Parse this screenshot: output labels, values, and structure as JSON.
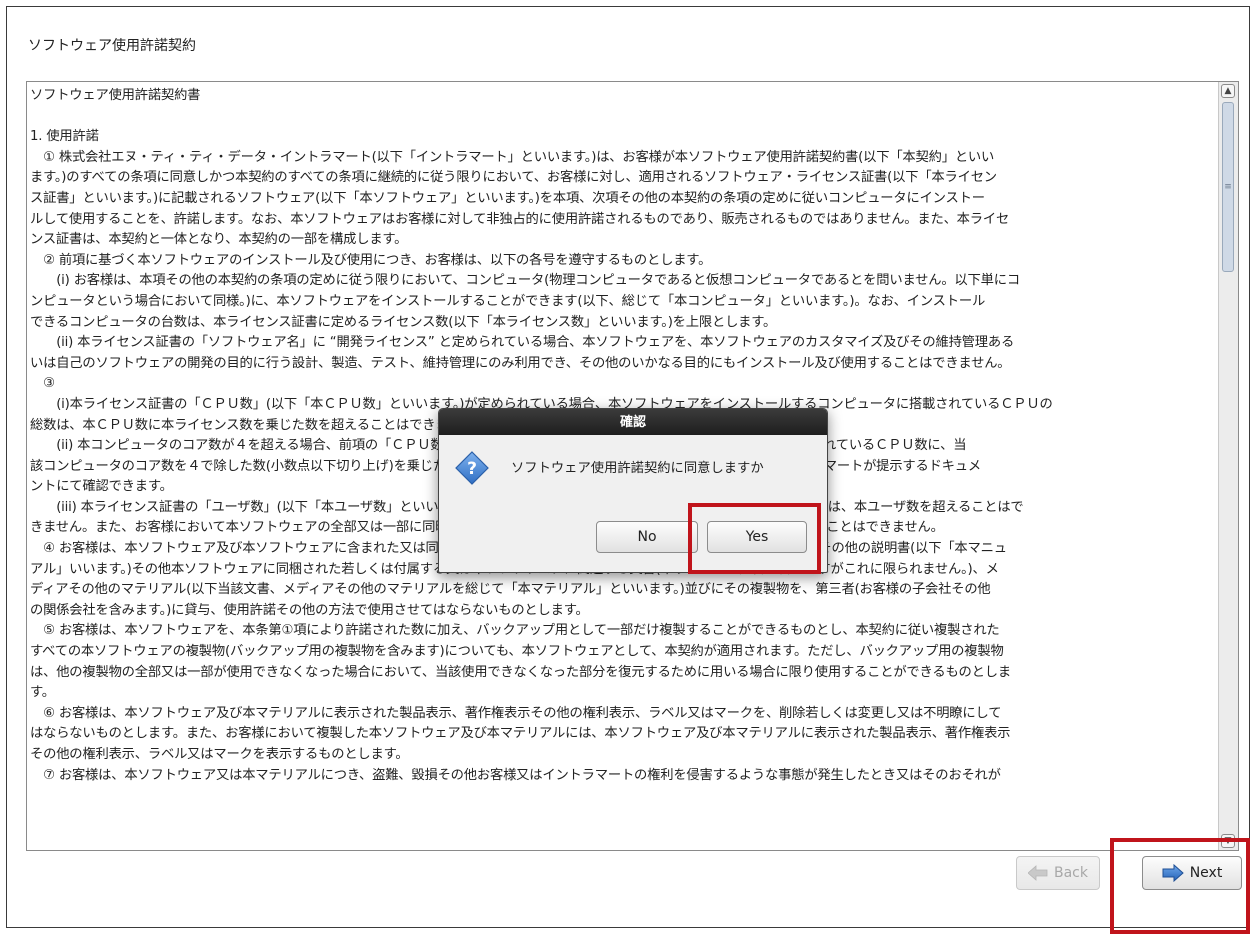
{
  "window": {
    "title": "ソフトウェア使用許諾契約"
  },
  "license": {
    "lines": [
      "ソフトウェア使用許諾契約書",
      "",
      "1. 使用許諾",
      "　① 株式会社エヌ・ティ・ティ・データ・イントラマート(以下「イントラマート」といいます。)は、お客様が本ソフトウェア使用許諾契約書(以下「本契約」といい",
      "ます。)のすべての条項に同意しかつ本契約のすべての条項に継続的に従う限りにおいて、お客様に対し、適用されるソフトウェア・ライセンス証書(以下「本ライセン",
      "ス証書」といいます。)に記載されるソフトウェア(以下「本ソフトウェア」といいます。)を本項、次項その他の本契約の条項の定めに従いコンピュータにインストー",
      "ルして使用することを、許諾します。なお、本ソフトウェアはお客様に対して非独占的に使用許諾されるものであり、販売されるものではありません。また、本ライセ",
      "ンス証書は、本契約と一体となり、本契約の一部を構成します。",
      "　② 前項に基づく本ソフトウェアのインストール及び使用につき、お客様は、以下の各号を遵守するものとします。",
      "　　(i) お客様は、本項その他の本契約の条項の定めに従う限りにおいて、コンピュータ(物理コンピュータであると仮想コンピュータであるとを問いません。以下単にコ",
      "ンピュータという場合において同様。)に、本ソフトウェアをインストールすることができます(以下、総じて「本コンピュータ」といいます。)。なお、インストール",
      "できるコンピュータの台数は、本ライセンス証書に定めるライセンス数(以下「本ライセンス数」といいます。)を上限とします。",
      "　　(ii) 本ライセンス証書の「ソフトウェア名」に “開発ライセンス” と定められている場合、本ソフトウェアを、本ソフトウェアのカスタマイズ及びその維持管理ある",
      "いは自己のソフトウェアの開発の目的に行う設計、製造、テスト、維持管理にのみ利用でき、その他のいかなる目的にもインストール及び使用することはできません。",
      "　③",
      "　　(i)本ライセンス証書の「ＣＰＵ数」(以下「本ＣＰＵ数」といいます。)が定められている場合、本ソフトウェアをインストールするコンピュータに搭載されているＣＰＵの",
      "総数は、本ＣＰＵ数に本ライセンス数を乗じた数を超えることはできません。",
      "　　(ii) 本コンピュータのコア数が４を超える場合、前項の「ＣＰＵ数」は、本ソフトウェアをインストールするコンピュータに搭載されているＣＰＵ数に、当",
      "該コンピュータのコア数を４で除した数(小数点以下切り上げ)を乗じた数とします。なお、コア数の算定方法については、別途イントラマートが提示するドキュメ",
      "ントにて確認できます。",
      "　　(iii) 本ライセンス証書の「ユーザ数」(以下「本ユーザ数」といいます。)が定められている場合、本ソフトウェアに登録するユーザ数は、本ユーザ数を超えることはで",
      "きません。また、お客様において本ソフトウェアの全部又は一部に同時にアクセスすることができるユーザの数は、本ユーザ数を超えることはできません。",
      "　④ お客様は、本ソフトウェア及び本ソフトウェアに含まれた又は同梱された若しくは付属する本ソフトウェアのセットアップガイドその他の説明書(以下「本マニュ",
      "アル」いいます。)その他本ソフトウェアに同梱された若しくは付属する又は本ソフトウェアに関連する文書(本ライセンス証書を含みますがこれに限られません。)、メ",
      "ディアその他のマテリアル(以下当該文書、メディアその他のマテリアルを総じて「本マテリアル」といいます。)並びにその複製物を、第三者(お客様の子会社その他",
      "の関係会社を含みます。)に貸与、使用許諾その他の方法で使用させてはならないものとします。",
      "　⑤ お客様は、本ソフトウェアを、本条第①項により許諾された数に加え、バックアップ用として一部だけ複製することができるものとし、本契約に従い複製された",
      "すべての本ソフトウェアの複製物(バックアップ用の複製物を含みます)についても、本ソフトウェアとして、本契約が適用されます。ただし、バックアップ用の複製物",
      "は、他の複製物の全部又は一部が使用できなくなった場合において、当該使用できなくなった部分を復元するために用いる場合に限り使用することができるものとしま",
      "す。",
      "　⑥ お客様は、本ソフトウェア及び本マテリアルに表示された製品表示、著作権表示その他の権利表示、ラベル又はマークを、削除若しくは変更し又は不明瞭にして",
      "はならないものとします。また、お客様において複製した本ソフトウェア及び本マテリアルには、本ソフトウェア及び本マテリアルに表示された製品表示、著作権表示",
      "その他の権利表示、ラベル又はマークを表示するものとします。",
      "　⑦ お客様は、本ソフトウェア又は本マテリアルにつき、盗難、毀損その他お客様又はイントラマートの権利を侵害するような事態が発生したとき又はそのおそれが"
    ]
  },
  "dialog": {
    "title": "確認",
    "message": "ソフトウェア使用許諾契約に同意しますか",
    "no_label": "No",
    "yes_label": "Yes"
  },
  "nav": {
    "back_label": "Back",
    "next_label": "Next"
  },
  "colors": {
    "highlight": "#c0141b",
    "dialog_title_bg": "#2a2a2a"
  },
  "icons": {
    "question": "question-icon",
    "back": "arrow-left-icon",
    "next": "arrow-right-icon"
  }
}
